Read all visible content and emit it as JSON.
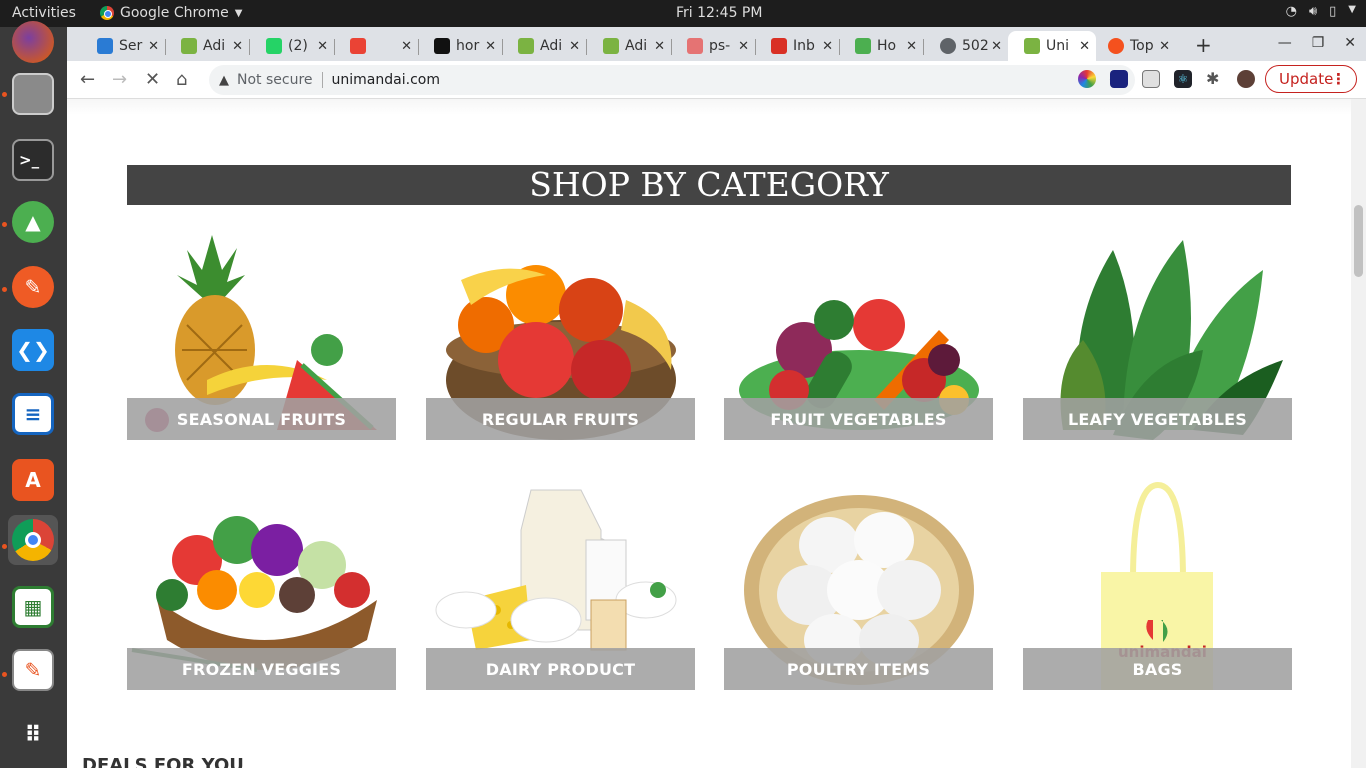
{
  "system": {
    "activities": "Activities",
    "app_name": "Google Chrome",
    "clock": "Fri 12:45 PM"
  },
  "tabs": [
    {
      "label": "Ser",
      "favicon": "mail-icon",
      "color": "#2a7bd4"
    },
    {
      "label": "Adi",
      "favicon": "leaf-icon",
      "color": "#7bb342"
    },
    {
      "label": "(2)",
      "favicon": "whatsapp-icon",
      "color": "#25d366"
    },
    {
      "label": "",
      "favicon": "meet-icon",
      "color": "#ea4335"
    },
    {
      "label": "hor",
      "favicon": "triangle-icon",
      "color": "#111111"
    },
    {
      "label": "Adi",
      "favicon": "leaf-icon",
      "color": "#7bb342"
    },
    {
      "label": "Adi",
      "favicon": "leaf-icon",
      "color": "#7bb342"
    },
    {
      "label": "ps-",
      "favicon": "stack-icon",
      "color": "#e57373"
    },
    {
      "label": "Inb",
      "favicon": "gmail-icon",
      "color": "#d93025"
    },
    {
      "label": "Ho",
      "favicon": "w3-icon",
      "color": "#4caf50"
    },
    {
      "label": "502",
      "favicon": "globe-icon",
      "color": "#5f6368"
    },
    {
      "label": "Uni",
      "favicon": "leaf-icon",
      "color": "#7bb342",
      "active": true
    },
    {
      "label": "Top",
      "favicon": "circle-icon",
      "color": "#f4511e"
    }
  ],
  "toolbar": {
    "not_secure": "Not secure",
    "url": "unimandai.com",
    "update_label": "Update"
  },
  "page": {
    "section_title": "SHOP BY CATEGORY",
    "categories": [
      {
        "label": "SEASONAL FRUITS"
      },
      {
        "label": "REGULAR FRUITS"
      },
      {
        "label": "FRUIT VEGETABLES"
      },
      {
        "label": "LEAFY VEGETABLES"
      },
      {
        "label": "FROZEN VEGGIES"
      },
      {
        "label": "DAIRY PRODUCT"
      },
      {
        "label": "POULTRY ITEMS"
      },
      {
        "label": "BAGS"
      }
    ],
    "bag_brand": "unimandai",
    "deals_heading": "DEALS FOR YOU"
  }
}
